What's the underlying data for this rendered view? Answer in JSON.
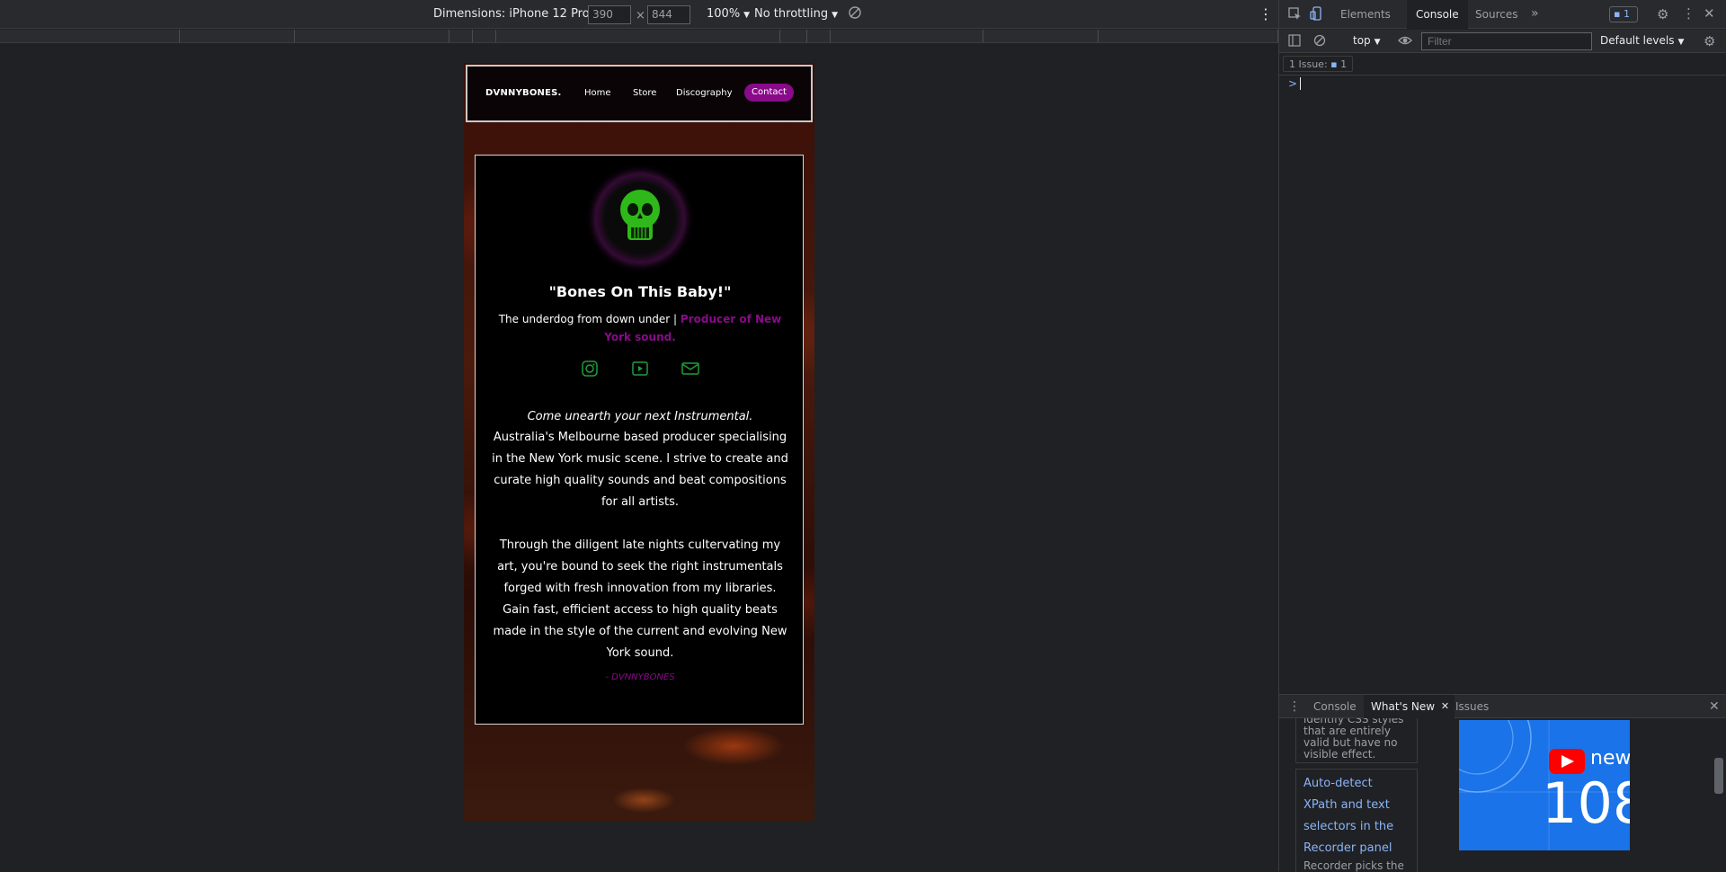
{
  "device_toolbar": {
    "dimensions_label": "Dimensions: iPhone 12 Pro",
    "width_value": "390",
    "times_sign": "×",
    "height_value": "844",
    "zoom": "100%",
    "throttling": "No throttling"
  },
  "site": {
    "logo": "DVNNYBONES.",
    "nav": [
      "Home",
      "Store",
      "Discography"
    ],
    "contact_label": "Contact",
    "headline": "\"Bones On This Baby!\"",
    "tagline_plain": "The underdog from down under | ",
    "tagline_accent": "Producer of New York sound.",
    "intro_italic": "Come unearth your next Instrumental.",
    "para1": "Australia's Melbourne based producer specialising in the New York music scene. I strive to create and curate high quality sounds and beat compositions for all artists.",
    "para2": "Through the diligent late nights cultervating my art, you're bound to seek the right instrumentals forged with fresh innovation from my libraries. Gain fast, efficient access to high quality beats made in the style of the current and evolving New York sound.",
    "signature": "- DVNNYBONES",
    "social_icons": [
      "instagram-icon",
      "youtube-icon",
      "mail-icon"
    ],
    "colors": {
      "accent": "#8a0a8a",
      "social_green": "#1f9e3a",
      "skull_green": "#39e01a"
    }
  },
  "devtools": {
    "tabs": [
      "Elements",
      "Console",
      "Sources"
    ],
    "active_tab": "Console",
    "issue_count": "1",
    "context": "top",
    "filter_placeholder": "Filter",
    "levels": "Default levels",
    "issues_label": "1 Issue:",
    "issues_count": "1",
    "prompt": ">",
    "drawer_tabs": [
      "Console",
      "What's New",
      "Issues"
    ],
    "feature1": "identify CSS styles that are entirely valid but have no visible effect.",
    "feature2_title": "Auto-detect XPath and text selectors in the Recorder panel",
    "feature2_desc": "Recorder picks the",
    "promo_new": "new",
    "promo_version": "108"
  }
}
